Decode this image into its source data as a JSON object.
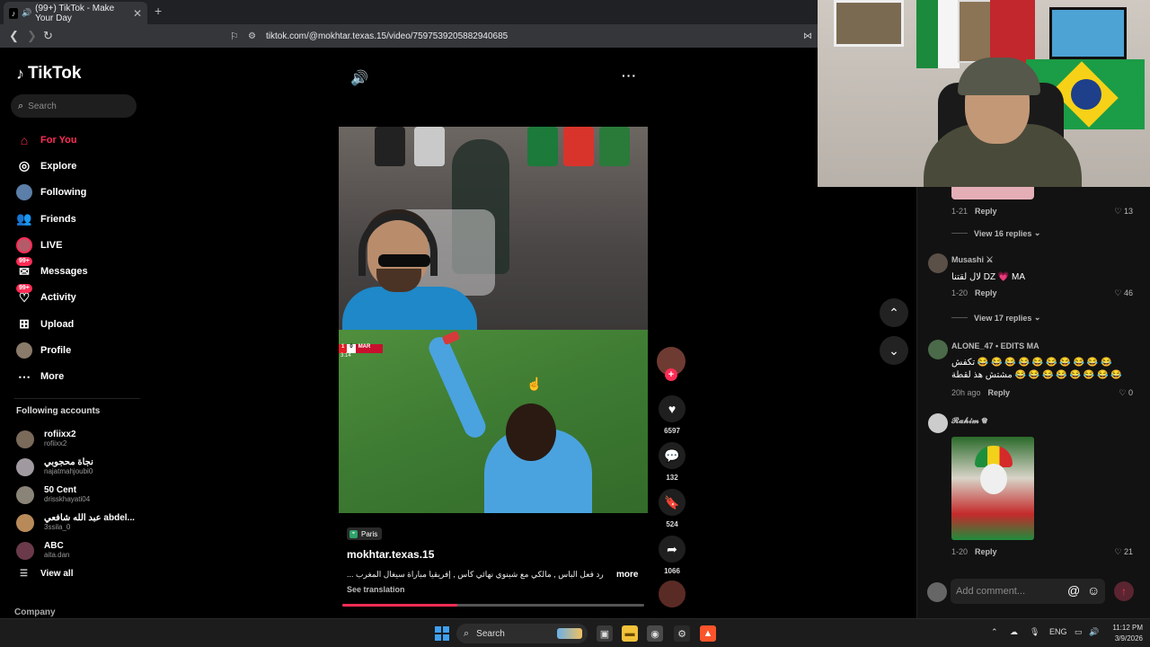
{
  "browser": {
    "tab_title": "(99+) TikTok - Make Your Day",
    "url": "tiktok.com/@mokhtar.texas.15/video/7597539205882940685"
  },
  "sidebar": {
    "logo_text": "TikTok",
    "search_placeholder": "Search",
    "nav": [
      {
        "label": "For You",
        "icon": "home-icon",
        "active": true
      },
      {
        "label": "Explore",
        "icon": "compass-icon"
      },
      {
        "label": "Following",
        "icon": "following-avatar-icon"
      },
      {
        "label": "Friends",
        "icon": "friends-icon"
      },
      {
        "label": "LIVE",
        "icon": "live-icon"
      },
      {
        "label": "Messages",
        "icon": "messages-icon",
        "badge": "99+"
      },
      {
        "label": "Activity",
        "icon": "activity-icon",
        "badge": "99+"
      },
      {
        "label": "Upload",
        "icon": "upload-icon"
      },
      {
        "label": "Profile",
        "icon": "profile-icon"
      },
      {
        "label": "More",
        "icon": "more-dots-icon"
      }
    ],
    "following_title": "Following accounts",
    "accounts": [
      {
        "name": "rofiixx2",
        "username": "rofiixx2"
      },
      {
        "name": "نجاة محجوبي",
        "username": "najatmahjoubi0"
      },
      {
        "name": "50 Cent",
        "username": "drisskhayati04"
      },
      {
        "name": "عبد الله شافعي abdel...",
        "username": "3ssila_0"
      },
      {
        "name": "ABC",
        "username": "aita.dan"
      }
    ],
    "view_all": "View all",
    "company": "Company"
  },
  "video": {
    "scorebug": {
      "team_a": "1",
      "score": "0",
      "team_b": "MAR",
      "time": "3:14"
    },
    "location": "Paris",
    "author": "mokhtar.texas.15",
    "caption": "... رد فعل الباس , مالكي مع شينوي نهائي كأس , إفريقيا مباراة سيغال المغرب",
    "more": "more",
    "see_translation": "See translation",
    "progress": 0.38
  },
  "actions": {
    "likes": "6597",
    "comments": "132",
    "saves": "524",
    "shares": "1066"
  },
  "comments": [
    {
      "meta": "1-21",
      "reply": "Reply",
      "likes": "13"
    },
    {
      "view_replies": "View 16 replies"
    },
    {
      "name": "Musashi ⚔",
      "text": "لال لقتنا DZ 💗 MA",
      "meta": "1-20",
      "reply": "Reply",
      "likes": "46"
    },
    {
      "view_replies": "View 17 replies"
    },
    {
      "name": "ALONE_47 • EDITS MA",
      "text_line1": "تكفش 😂 😂 😂 😂 😂 😂 😂 😂 😂 😂",
      "text_line2": "مشتش هذ لقطة 😂 😂 😂 😂 😂 😂 😂 😂",
      "meta": "20h ago",
      "reply": "Reply",
      "likes": "0"
    },
    {
      "name": "𝓡𝓪𝓱𝓲𝓶 ♛",
      "meta": "1-20",
      "reply": "Reply",
      "likes": "21"
    }
  ],
  "comment_bar": {
    "placeholder": "Add comment...",
    "at": "@",
    "emoji": "☺"
  },
  "taskbar": {
    "search": "Search",
    "lang": "ENG",
    "time": "11:12 PM",
    "date": "3/9/2026"
  },
  "colors": {
    "accent": "#fe2c55",
    "background": "#000000"
  }
}
